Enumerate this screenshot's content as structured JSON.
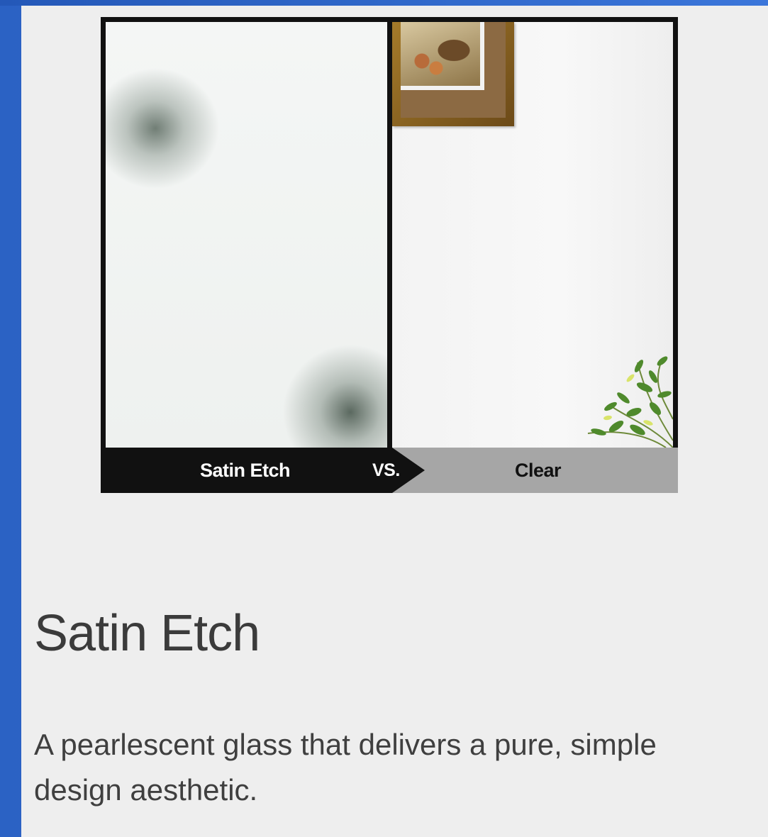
{
  "comparison": {
    "left_label": "Satin Etch",
    "vs_label": "VS.",
    "right_label": "Clear"
  },
  "product": {
    "title": "Satin Etch",
    "description_line1": "A pearlescent glass that delivers a pure, simple",
    "description_line2": "design aesthetic."
  },
  "colors": {
    "background_blue": "#2f66c8",
    "panel": "#eeeeee",
    "label_dark": "#111111",
    "label_gray": "#a6a6a6"
  },
  "icons": {
    "decoration_plant": "plant-icon",
    "decoration_frame": "picture-frame-icon"
  }
}
